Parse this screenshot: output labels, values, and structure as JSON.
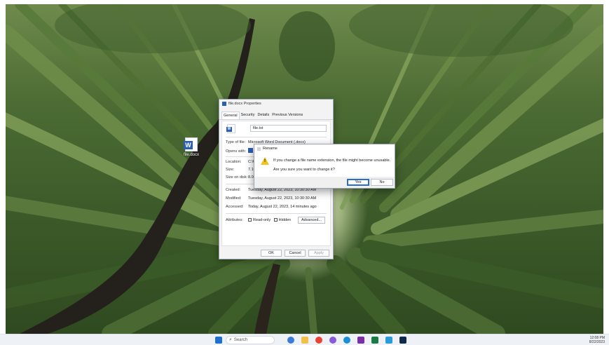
{
  "desktop": {
    "icons": [
      {
        "label": "file.docx",
        "type": "word-document"
      }
    ]
  },
  "properties_dialog": {
    "title": "file.docx Properties",
    "tabs": [
      "General",
      "Security",
      "Details",
      "Previous Versions"
    ],
    "active_tab": "General",
    "file_name_value": "file.txt",
    "type_of_file_label": "Type of file:",
    "type_of_file_value": "Microsoft Word Document (.docx)",
    "opens_with_label": "Opens with:",
    "location_label": "Location:",
    "location_value": "C:\\U",
    "size_label": "Size:",
    "size_value": "7.10",
    "size_on_disk_label": "Size on disk:",
    "size_on_disk_value": "8.00",
    "created_label": "Created:",
    "created_value": "Tuesday, August 22, 2023, 10:30:30 AM",
    "modified_label": "Modified:",
    "modified_value": "Tuesday, August 22, 2023, 10:30:30 AM",
    "accessed_label": "Accessed:",
    "accessed_value": "Today, August 22, 2023, 14 minutes ago",
    "attributes_label": "Attributes:",
    "readonly_label": "Read-only",
    "hidden_label": "Hidden",
    "advanced_label": "Advanced...",
    "ok_label": "OK",
    "cancel_label": "Cancel",
    "apply_label": "Apply"
  },
  "rename_dialog": {
    "title": "Rename",
    "message_line1": "If you change a file name extension, the file might become unusable.",
    "message_line2": "Are you sure you want to change it?",
    "yes_label": "Yes",
    "no_label": "No"
  },
  "taskbar": {
    "search_placeholder": "Search",
    "time": "12:08 PM",
    "date": "8/22/2023",
    "pinned_apps": [
      "start",
      "search",
      "task-view",
      "file-explorer",
      "chrome",
      "copilot",
      "edge",
      "onenote",
      "excel",
      "notepad",
      "photoshop"
    ]
  },
  "colors": {
    "accent": "#2b6cd1",
    "word_blue": "#2b5fb6",
    "warning_yellow": "#f3c21b",
    "taskbar_bg": "#eef1f5"
  }
}
